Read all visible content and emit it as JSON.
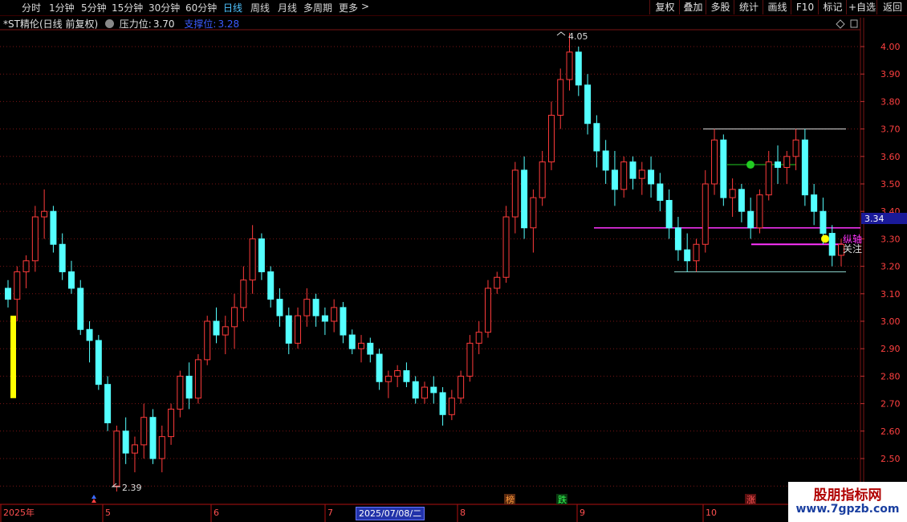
{
  "toolbar": {
    "periods": [
      "分时",
      "1分钟",
      "5分钟",
      "15分钟",
      "30分钟",
      "60分钟",
      "日线",
      "周线",
      "月线",
      "多周期",
      "更多"
    ],
    "active_period": "日线",
    "more_arrow": ">",
    "right_buttons": [
      "复权",
      "叠加",
      "多股",
      "统计",
      "画线",
      "F10",
      "标记",
      "+自选",
      "返回"
    ]
  },
  "info": {
    "title": "*ST精伦(日线 前复权)",
    "pressure_label": "压力位:",
    "pressure_value": "3.70",
    "support_label": "支撑位:",
    "support_value": "3.28"
  },
  "price_axis": {
    "ticks": [
      "4.00",
      "3.90",
      "3.80",
      "3.70",
      "3.60",
      "3.50",
      "3.40",
      "3.30",
      "3.20",
      "3.10",
      "3.00",
      "2.90",
      "2.80",
      "2.70",
      "2.60",
      "2.50"
    ],
    "current_price": "3.34"
  },
  "annotations": {
    "high_label": "4.05",
    "low_label": "2.39",
    "marker_bang": "榜",
    "marker_fall": "跌",
    "marker_rise": "涨",
    "text_zhongxian": "纵轴",
    "text_guanzhu": "关注"
  },
  "time_axis": {
    "labels": [
      "2025年",
      "5",
      "6",
      "7",
      "8",
      "9",
      "10"
    ],
    "cursor_date": "2025/07/08/二"
  },
  "watermark": {
    "line1": "股朋指标网",
    "line2": "www.7gpzb.com"
  },
  "colors": {
    "up": "#ff3b3b",
    "down": "#54ffff",
    "grid": "#7a1515",
    "active": "#4fc3ff",
    "magenta": "#ff33ff",
    "yellow": "#ffff00",
    "green": "#22cc22"
  },
  "chart_data": {
    "type": "candlestick",
    "ylim": [
      2.39,
      4.05
    ],
    "ohlc": [
      [
        3.12,
        3.15,
        3.05,
        3.08
      ],
      [
        3.08,
        3.2,
        3.0,
        3.18
      ],
      [
        3.18,
        3.24,
        3.12,
        3.22
      ],
      [
        3.22,
        3.42,
        3.18,
        3.38
      ],
      [
        3.38,
        3.48,
        3.3,
        3.4
      ],
      [
        3.4,
        3.42,
        3.25,
        3.28
      ],
      [
        3.28,
        3.32,
        3.15,
        3.18
      ],
      [
        3.18,
        3.22,
        3.1,
        3.12
      ],
      [
        3.12,
        3.15,
        2.95,
        2.97
      ],
      [
        2.97,
        3.0,
        2.85,
        2.93
      ],
      [
        2.93,
        2.95,
        2.75,
        2.77
      ],
      [
        2.77,
        2.8,
        2.6,
        2.63
      ],
      [
        2.4,
        2.62,
        2.38,
        2.6
      ],
      [
        2.6,
        2.65,
        2.48,
        2.52
      ],
      [
        2.52,
        2.58,
        2.45,
        2.55
      ],
      [
        2.55,
        2.7,
        2.5,
        2.65
      ],
      [
        2.65,
        2.68,
        2.48,
        2.5
      ],
      [
        2.5,
        2.62,
        2.45,
        2.58
      ],
      [
        2.58,
        2.7,
        2.55,
        2.68
      ],
      [
        2.68,
        2.82,
        2.65,
        2.8
      ],
      [
        2.8,
        2.85,
        2.68,
        2.72
      ],
      [
        2.72,
        2.88,
        2.7,
        2.86
      ],
      [
        2.86,
        3.02,
        2.84,
        3.0
      ],
      [
        3.0,
        3.05,
        2.92,
        2.95
      ],
      [
        2.95,
        3.02,
        2.88,
        2.98
      ],
      [
        2.98,
        3.1,
        2.9,
        3.05
      ],
      [
        3.05,
        3.2,
        3.0,
        3.15
      ],
      [
        3.15,
        3.35,
        3.1,
        3.3
      ],
      [
        3.3,
        3.32,
        3.15,
        3.18
      ],
      [
        3.18,
        3.2,
        3.05,
        3.08
      ],
      [
        3.08,
        3.12,
        2.98,
        3.02
      ],
      [
        3.02,
        3.05,
        2.88,
        2.92
      ],
      [
        2.92,
        3.05,
        2.9,
        3.02
      ],
      [
        3.02,
        3.12,
        2.98,
        3.08
      ],
      [
        3.08,
        3.1,
        2.98,
        3.02
      ],
      [
        3.02,
        3.05,
        2.95,
        3.0
      ],
      [
        3.0,
        3.08,
        2.96,
        3.05
      ],
      [
        3.05,
        3.07,
        2.92,
        2.95
      ],
      [
        2.95,
        2.97,
        2.88,
        2.9
      ],
      [
        2.9,
        2.95,
        2.85,
        2.92
      ],
      [
        2.92,
        2.94,
        2.85,
        2.88
      ],
      [
        2.88,
        2.9,
        2.75,
        2.78
      ],
      [
        2.78,
        2.82,
        2.72,
        2.8
      ],
      [
        2.8,
        2.84,
        2.76,
        2.82
      ],
      [
        2.82,
        2.85,
        2.76,
        2.78
      ],
      [
        2.78,
        2.8,
        2.7,
        2.72
      ],
      [
        2.72,
        2.78,
        2.7,
        2.76
      ],
      [
        2.76,
        2.8,
        2.7,
        2.74
      ],
      [
        2.74,
        2.76,
        2.62,
        2.66
      ],
      [
        2.66,
        2.75,
        2.64,
        2.72
      ],
      [
        2.72,
        2.82,
        2.7,
        2.8
      ],
      [
        2.8,
        2.95,
        2.78,
        2.92
      ],
      [
        2.92,
        3.0,
        2.88,
        2.96
      ],
      [
        2.96,
        3.15,
        2.94,
        3.12
      ],
      [
        3.12,
        3.18,
        3.1,
        3.16
      ],
      [
        3.16,
        3.42,
        3.14,
        3.38
      ],
      [
        3.38,
        3.58,
        3.32,
        3.55
      ],
      [
        3.55,
        3.6,
        3.3,
        3.34
      ],
      [
        3.34,
        3.48,
        3.25,
        3.45
      ],
      [
        3.45,
        3.62,
        3.42,
        3.58
      ],
      [
        3.58,
        3.8,
        3.55,
        3.75
      ],
      [
        3.75,
        3.92,
        3.7,
        3.88
      ],
      [
        3.88,
        4.05,
        3.84,
        3.98
      ],
      [
        3.98,
        4.0,
        3.82,
        3.86
      ],
      [
        3.86,
        3.9,
        3.68,
        3.72
      ],
      [
        3.72,
        3.75,
        3.56,
        3.62
      ],
      [
        3.62,
        3.66,
        3.5,
        3.55
      ],
      [
        3.55,
        3.62,
        3.42,
        3.48
      ],
      [
        3.48,
        3.6,
        3.45,
        3.58
      ],
      [
        3.58,
        3.6,
        3.48,
        3.52
      ],
      [
        3.52,
        3.58,
        3.46,
        3.55
      ],
      [
        3.55,
        3.6,
        3.45,
        3.5
      ],
      [
        3.5,
        3.54,
        3.4,
        3.44
      ],
      [
        3.44,
        3.48,
        3.3,
        3.34
      ],
      [
        3.34,
        3.38,
        3.22,
        3.26
      ],
      [
        3.26,
        3.32,
        3.18,
        3.22
      ],
      [
        3.22,
        3.3,
        3.18,
        3.28
      ],
      [
        3.28,
        3.55,
        3.25,
        3.5
      ],
      [
        3.5,
        3.7,
        3.46,
        3.66
      ],
      [
        3.66,
        3.68,
        3.42,
        3.45
      ],
      [
        3.45,
        3.52,
        3.38,
        3.48
      ],
      [
        3.48,
        3.5,
        3.36,
        3.4
      ],
      [
        3.4,
        3.45,
        3.3,
        3.34
      ],
      [
        3.34,
        3.48,
        3.32,
        3.46
      ],
      [
        3.46,
        3.62,
        3.44,
        3.58
      ],
      [
        3.58,
        3.64,
        3.5,
        3.56
      ],
      [
        3.56,
        3.62,
        3.5,
        3.6
      ],
      [
        3.6,
        3.7,
        3.55,
        3.66
      ],
      [
        3.66,
        3.7,
        3.42,
        3.46
      ],
      [
        3.46,
        3.5,
        3.35,
        3.4
      ],
      [
        3.4,
        3.45,
        3.28,
        3.32
      ],
      [
        3.32,
        3.35,
        3.2,
        3.24
      ],
      [
        3.24,
        3.3,
        3.2,
        3.28
      ]
    ],
    "levels": {
      "pressure": 3.7,
      "support": 3.28,
      "line_magenta": 3.34,
      "line_bottom": 3.18
    },
    "x_labels": [
      "2025年",
      "5",
      "6",
      "7",
      "8",
      "9",
      "10"
    ]
  }
}
